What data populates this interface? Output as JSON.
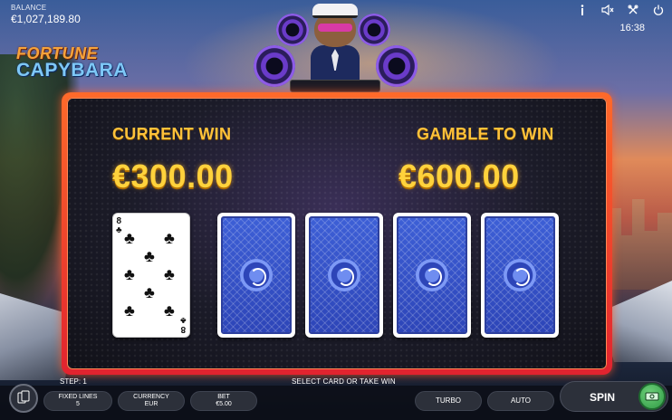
{
  "balance": {
    "label": "BALANCE",
    "value": "€1,027,189.80"
  },
  "clock": "16:38",
  "top_icons": [
    "info-icon",
    "sound-muted-icon",
    "settings-icon",
    "power-icon"
  ],
  "logo": {
    "line1": "FORTUNE",
    "line2": "CAPYBARA"
  },
  "gamble": {
    "current_win_label": "CURRENT WIN",
    "current_win_value": "€300.00",
    "gamble_to_win_label": "GAMBLE TO WIN",
    "gamble_to_win_value": "€600.00",
    "dealer_card": {
      "rank": "8",
      "suit": "clubs",
      "suit_symbol": "♣",
      "face_up": true
    },
    "hidden_cards": 4
  },
  "status": {
    "step": "STEP: 1",
    "instruction": "SELECT CARD OR TAKE WIN"
  },
  "bottom": {
    "fixed_lines_label": "FIXED LINES",
    "fixed_lines_value": "5",
    "currency_label": "CURRENCY",
    "currency_value": "EUR",
    "bet_label": "BET",
    "bet_value": "€5.00",
    "turbo_label": "TURBO",
    "auto_label": "AUTO",
    "spin_label": "SPIN"
  },
  "colors": {
    "frame": "#ff6a2a",
    "win_gold": "#ffd23c",
    "card_back": "#3d5fd6",
    "spin_accent": "#2f9a45"
  }
}
